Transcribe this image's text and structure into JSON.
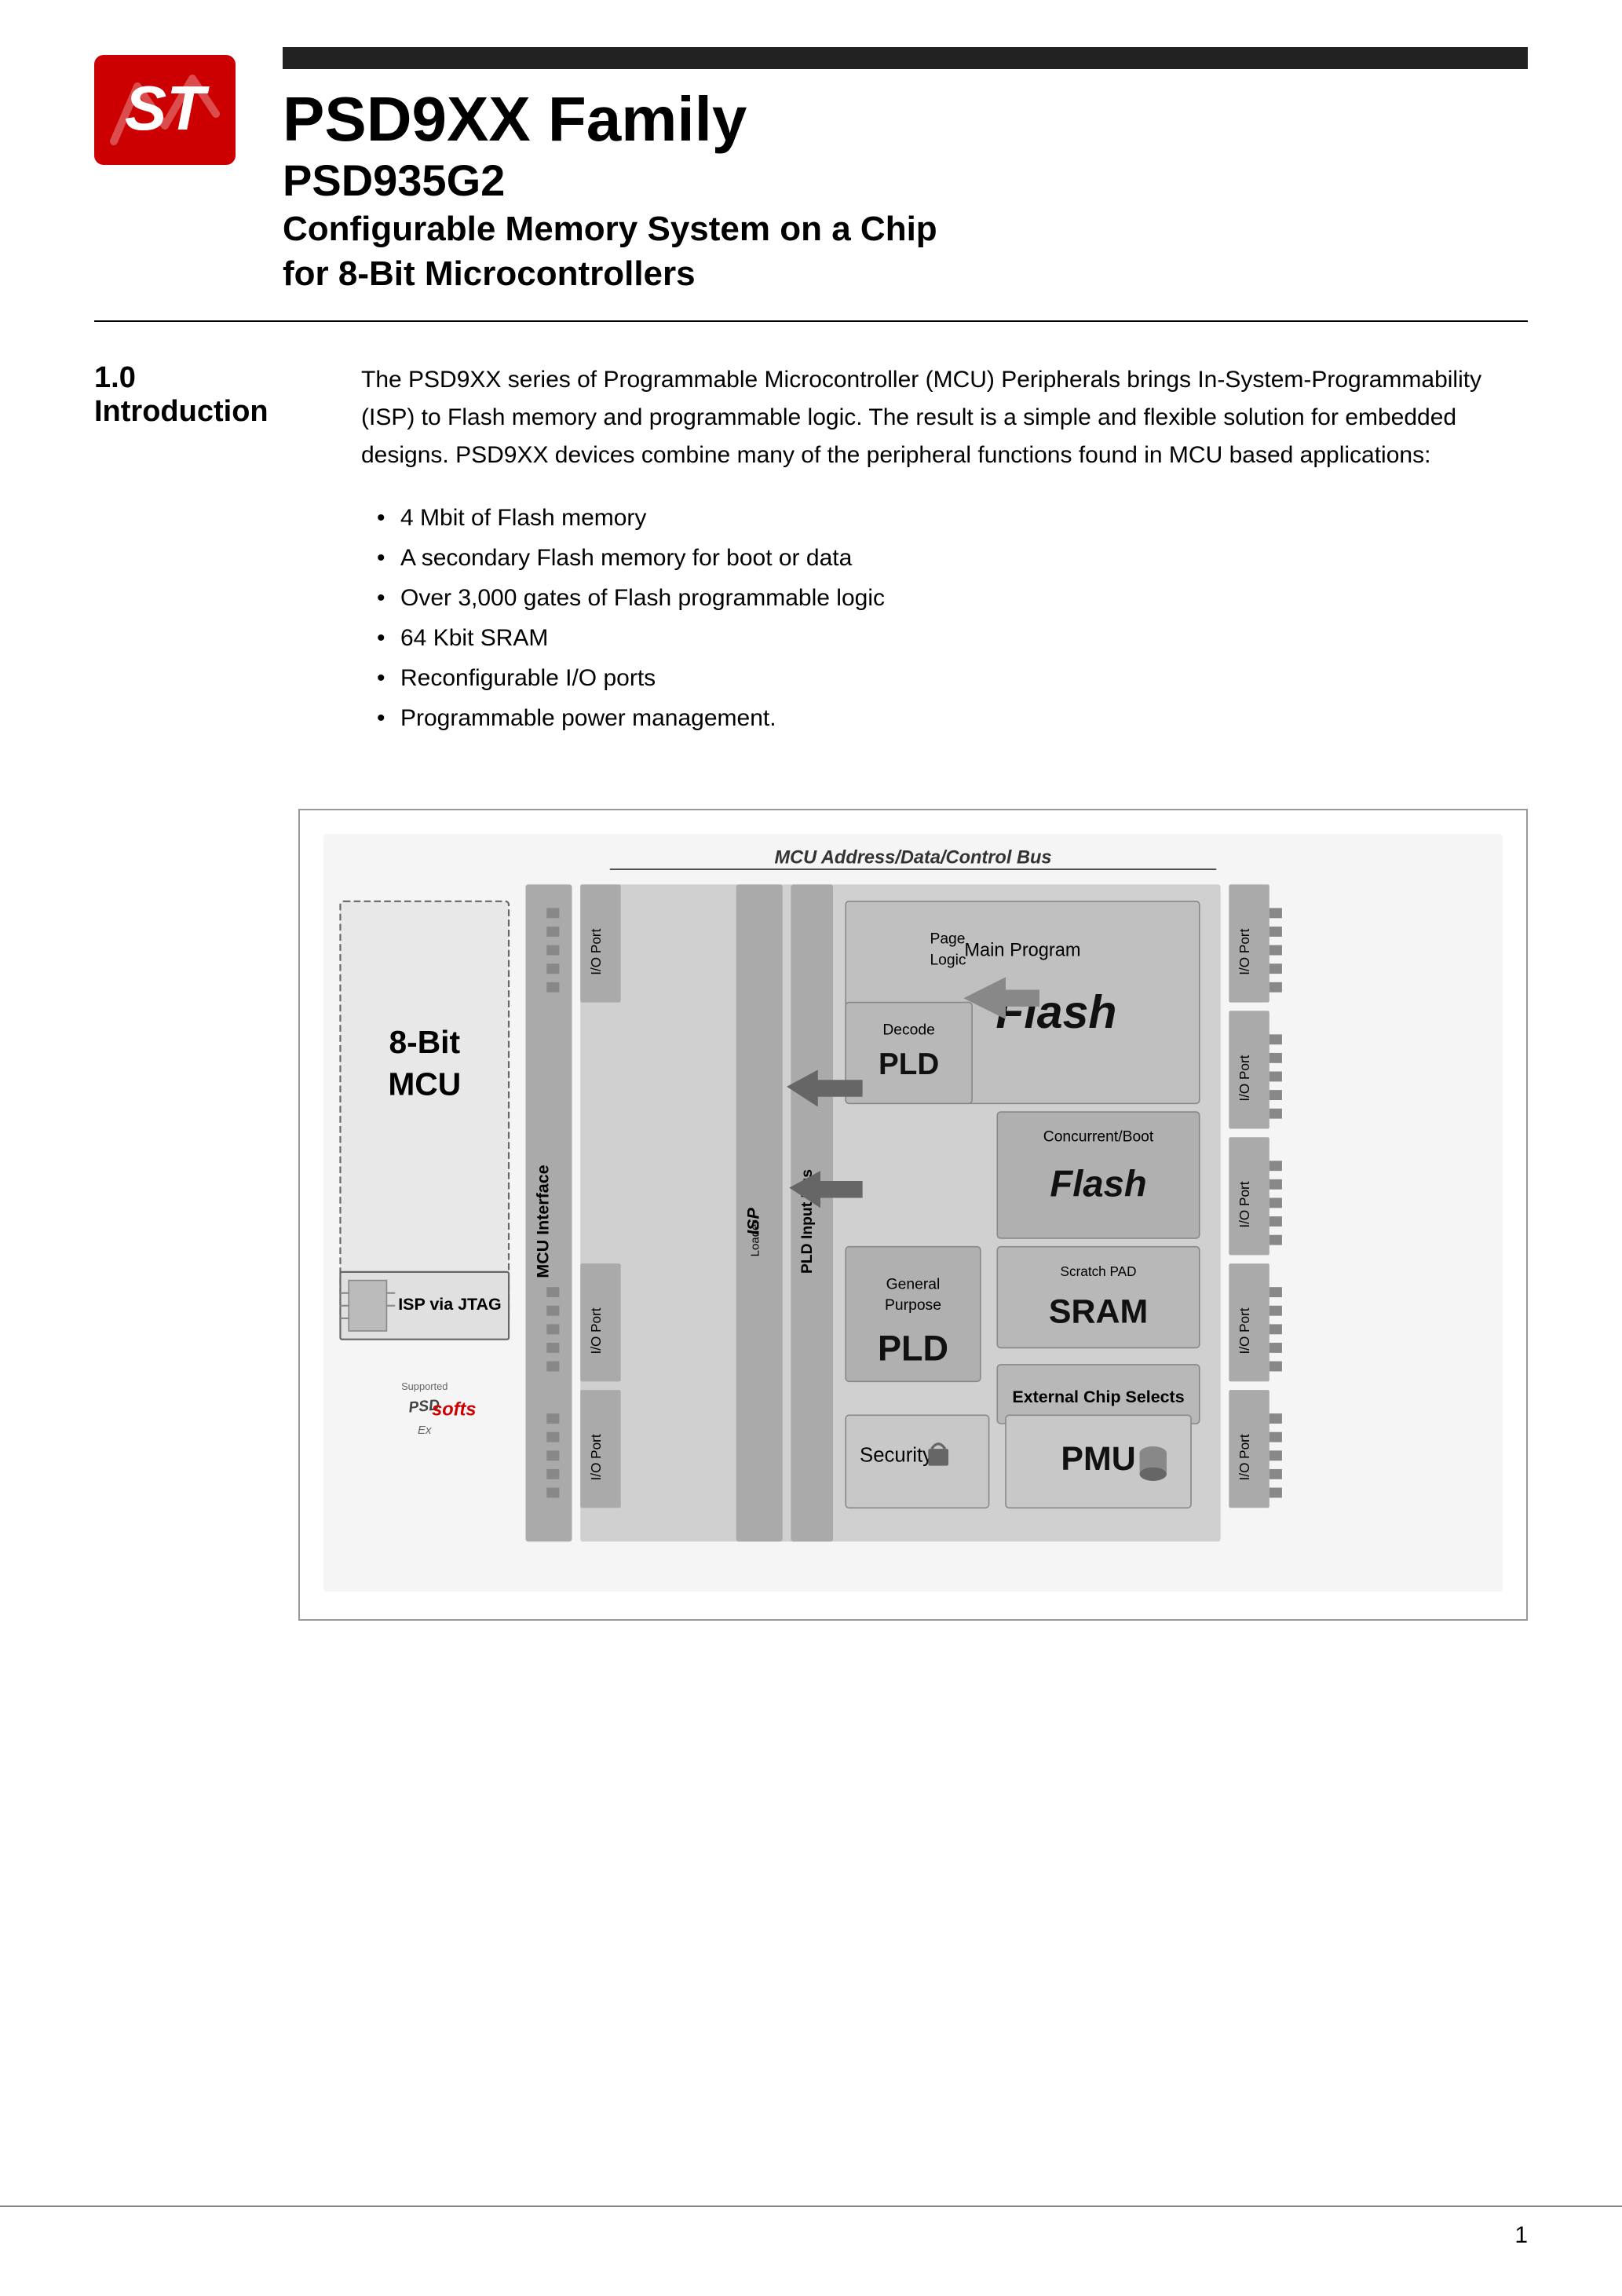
{
  "header": {
    "top_bar_color": "#222222",
    "main_title": "PSD9XX Family",
    "sub_title": "PSD935G2",
    "description_line1": "Configurable Memory System on a Chip",
    "description_line2": "for 8-Bit Microcontrollers"
  },
  "section": {
    "number": "1.0",
    "name": "Introduction"
  },
  "intro": {
    "paragraph": "The PSD9XX series of Programmable Microcontroller (MCU) Peripherals brings In-System-Programmability (ISP) to Flash memory and programmable logic. The result is a simple and flexible solution for embedded designs. PSD9XX devices combine many of the peripheral functions found in MCU based applications:",
    "bullets": [
      "4 Mbit of Flash memory",
      "A secondary Flash memory for boot or data",
      "Over 3,000 gates of Flash programmable logic",
      "64 Kbit SRAM",
      "Reconfigurable I/O ports",
      "Programmable power management."
    ]
  },
  "diagram": {
    "title": "MCU Address/Data/Control Bus",
    "blocks": {
      "mcu": "8-Bit\nMCU",
      "mcu_interface": "MCU Interface",
      "page_logic": "Page Logic",
      "main_program": "Main Program",
      "main_flash": "Flash",
      "decode": "Decode",
      "pld_top": "PLD",
      "concurrent_boot": "Concurrent/Boot",
      "boot_flash": "Flash",
      "isp_via_jtag": "ISP via JTAG",
      "isp": "ISP",
      "isp_loader": "Loader",
      "scratch_pad": "Scratch PAD",
      "sram": "SRAM",
      "general_purpose": "General\nPurpose",
      "pld_bottom": "PLD",
      "external_chip": "External Chip Selects",
      "pld_input_bus": "PLD Input Bus",
      "security": "Security",
      "pmu": "PMU",
      "io_port_labels": [
        "I/O Port",
        "I/O Port",
        "I/O Port",
        "I/O Port",
        "I/O Port",
        "I/O Port"
      ]
    }
  },
  "footer": {
    "page_number": "1"
  }
}
